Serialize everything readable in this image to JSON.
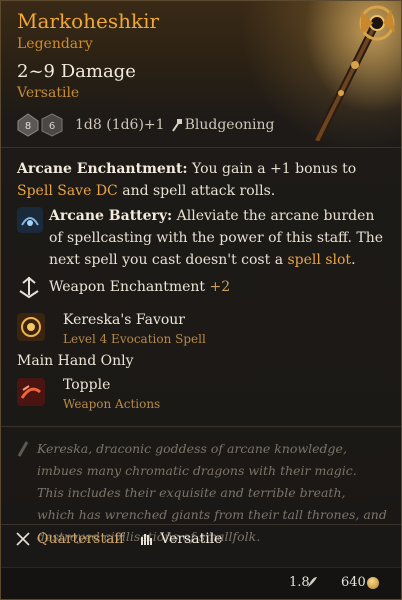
{
  "item": {
    "name": "Markoheshkir",
    "rarity": "Legendary",
    "damage": "2~9 Damage",
    "property": "Versatile",
    "dice_formula": "1d8 (1d6)+1",
    "damage_type": "Bludgeoning",
    "die_icons": [
      "d8-die-icon",
      "d6-die-icon"
    ]
  },
  "enchantment": {
    "title": "Arcane Enchantment:",
    "text_a": " You gain a +1 bonus to ",
    "link_a": "Spell Save DC",
    "text_b": " and spell attack rolls."
  },
  "battery": {
    "title": "Arcane Battery:",
    "text_a": " Alleviate the arcane burden of spellcasting with the power of this staff. The next spell you cast doesn't cost a ",
    "link_a": "spell slot",
    "text_b": "."
  },
  "weapon_enchantment": {
    "label": "Weapon Enchantment",
    "value": "+2"
  },
  "spell": {
    "name": "Kereska's Favour",
    "detail": "Level 4 Evocation Spell"
  },
  "main_hand": "Main Hand Only",
  "action": {
    "name": "Topple",
    "detail": "Weapon Actions"
  },
  "flavor": "Kereska, draconic goddess of arcane knowledge, imbues many chromatic dragons with their magic. This includes their exquisite and terrible breath, which has wrenched giants from their tall thrones, and destroyed civilisations of smallfolk.",
  "footer": {
    "type": "Quarterstaff",
    "property": "Versatile"
  },
  "meta": {
    "weight": "1.8",
    "price": "640"
  },
  "colors": {
    "name": "#f0a63a",
    "rarity": "#d08a30",
    "highlight": "#e8a44a"
  }
}
